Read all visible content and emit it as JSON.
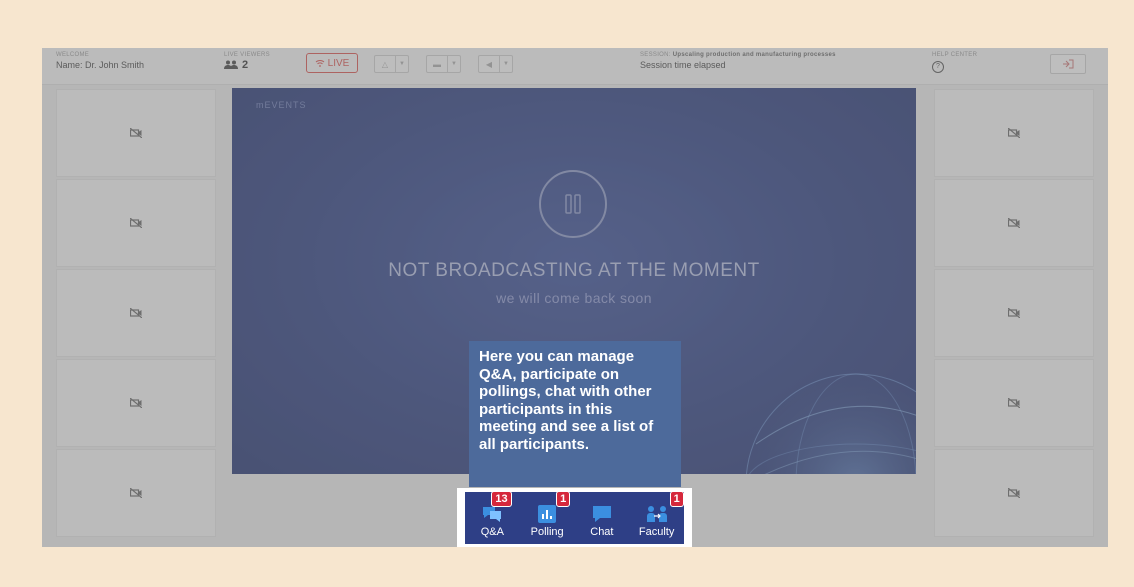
{
  "topbar": {
    "welcome_label": "WELCOME",
    "welcome_name": "Name: Dr. John Smith",
    "viewers_label": "LIVE VIEWERS",
    "viewers_count": "2",
    "live_label": "LIVE",
    "session_label": "SESSION:",
    "session_title": "Upscaling production and manufacturing processes",
    "session_time": "Session time elapsed",
    "help_label": "HELP CENTER",
    "help_icon": "?"
  },
  "stage": {
    "brand": "mEVENTS",
    "headline": "NOT BROADCASTING AT THE MOMENT",
    "subline": "we will come back soon"
  },
  "tooltip": {
    "text": "Here you can manage Q&A, participate on pollings, chat with other participants in this meeting and see a list of all participants."
  },
  "toolbar": {
    "items": [
      {
        "label": "Q&A",
        "badge": "13",
        "icon": "qa-icon"
      },
      {
        "label": "Polling",
        "badge": "1",
        "icon": "polling-icon"
      },
      {
        "label": "Chat",
        "badge": "",
        "icon": "chat-icon"
      },
      {
        "label": "Faculty",
        "badge": "1",
        "icon": "faculty-icon"
      }
    ]
  },
  "colors": {
    "page_bg": "#f7e6cf",
    "stage_bg": "#2b3d80",
    "tooltip_bg": "#4d6a9b",
    "toolbar_bg": "#2e3f86",
    "badge": "#d5283c",
    "live": "#d9534f"
  }
}
